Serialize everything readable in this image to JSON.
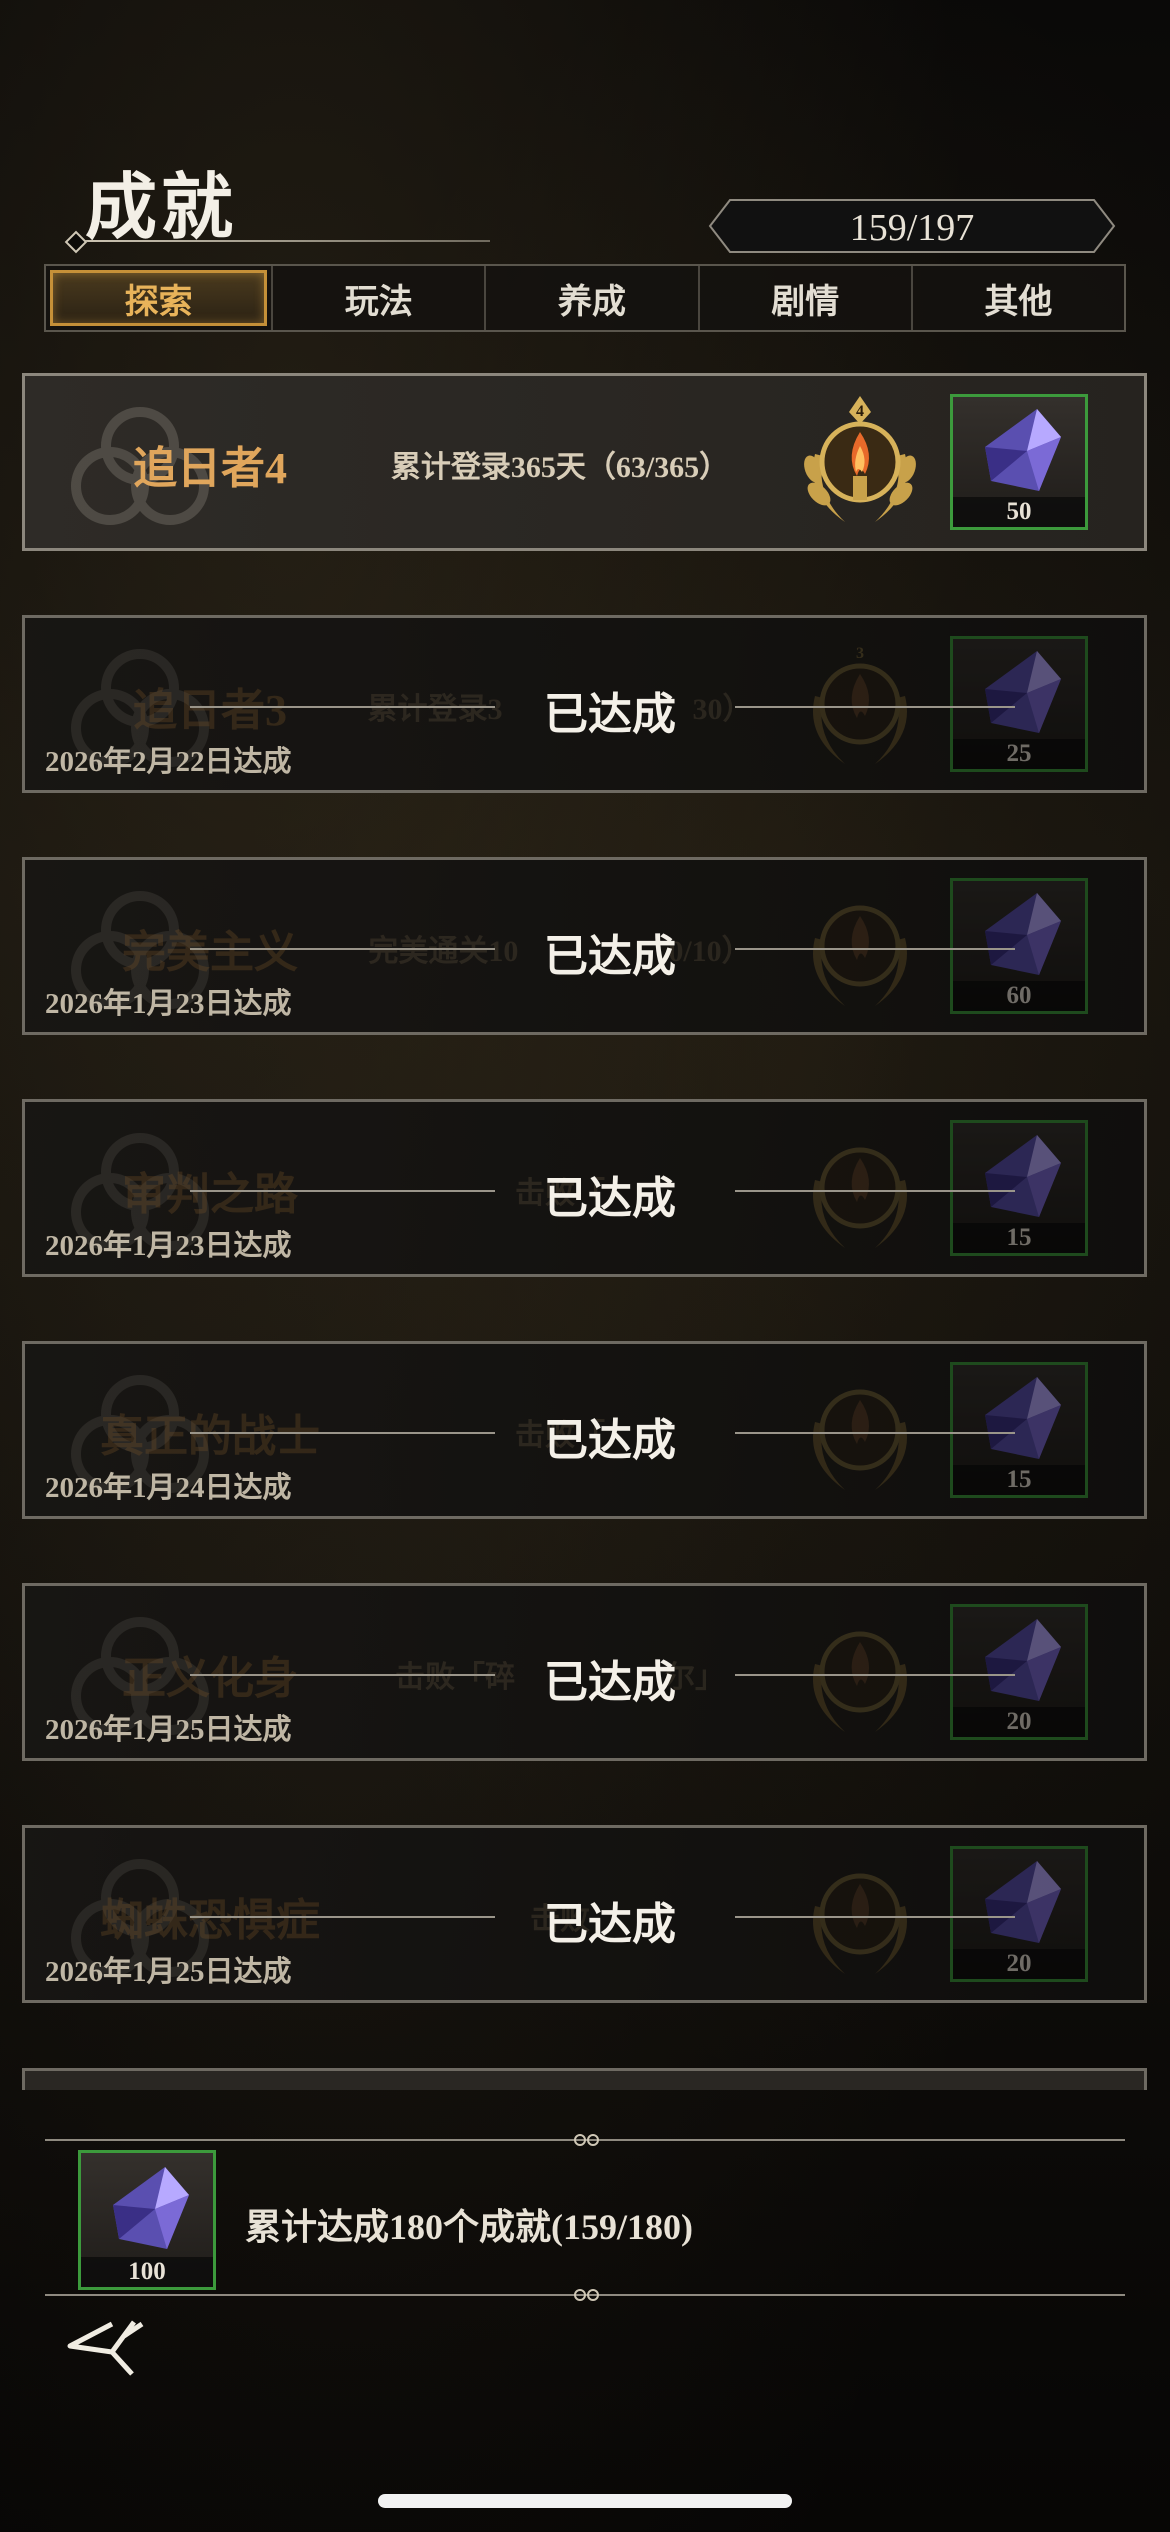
{
  "header": {
    "title": "成就",
    "progress": "159/197"
  },
  "tabs": [
    {
      "label": "探索",
      "active": true
    },
    {
      "label": "玩法",
      "active": false
    },
    {
      "label": "养成",
      "active": false
    },
    {
      "label": "剧情",
      "active": false
    },
    {
      "label": "其他",
      "active": false
    }
  ],
  "achievements": [
    {
      "name": "追日者4",
      "desc": "累计登录365天（63/365）",
      "reward": "50",
      "medal_num": "4",
      "completed": false
    },
    {
      "name": "追日者3",
      "desc": "累计登录3",
      "desc_tail": "30）",
      "reward": "25",
      "medal_num": "3",
      "completed": true,
      "date": "2026年2月22日达成",
      "status": "已达成"
    },
    {
      "name": "完美主义",
      "desc": "完美通关10",
      "desc_tail": "0/10）",
      "reward": "60",
      "completed": true,
      "date": "2026年1月23日达成",
      "status": "已达成"
    },
    {
      "name": "审判之路",
      "desc": "击败「",
      "desc_tail": "",
      "reward": "15",
      "completed": true,
      "date": "2026年1月23日达成",
      "status": "已达成"
    },
    {
      "name": "真正的战士",
      "desc": "击败「",
      "desc_tail": "",
      "reward": "15",
      "completed": true,
      "date": "2026年1月24日达成",
      "status": "已达成"
    },
    {
      "name": "正义化身",
      "desc": "击败「碎",
      "desc_tail": "尔」",
      "reward": "20",
      "completed": true,
      "date": "2026年1月25日达成",
      "status": "已达成"
    },
    {
      "name": "蜘蛛恐惧症",
      "desc": "击败",
      "desc_tail": "",
      "reward": "20",
      "completed": true,
      "date": "2026年1月25日达成",
      "status": "已达成"
    }
  ],
  "bottom": {
    "reward": "100",
    "text": "累计达成180个成就(159/180)"
  },
  "colors": {
    "accent_gold": "#e0a65c",
    "reward_border": "#3c9a3c",
    "tab_active": "#e8b35a"
  },
  "icons": {
    "back": "back-arrow-icon",
    "reward": "crystal-icon",
    "medal": "laurel-torch-medal-icon"
  }
}
